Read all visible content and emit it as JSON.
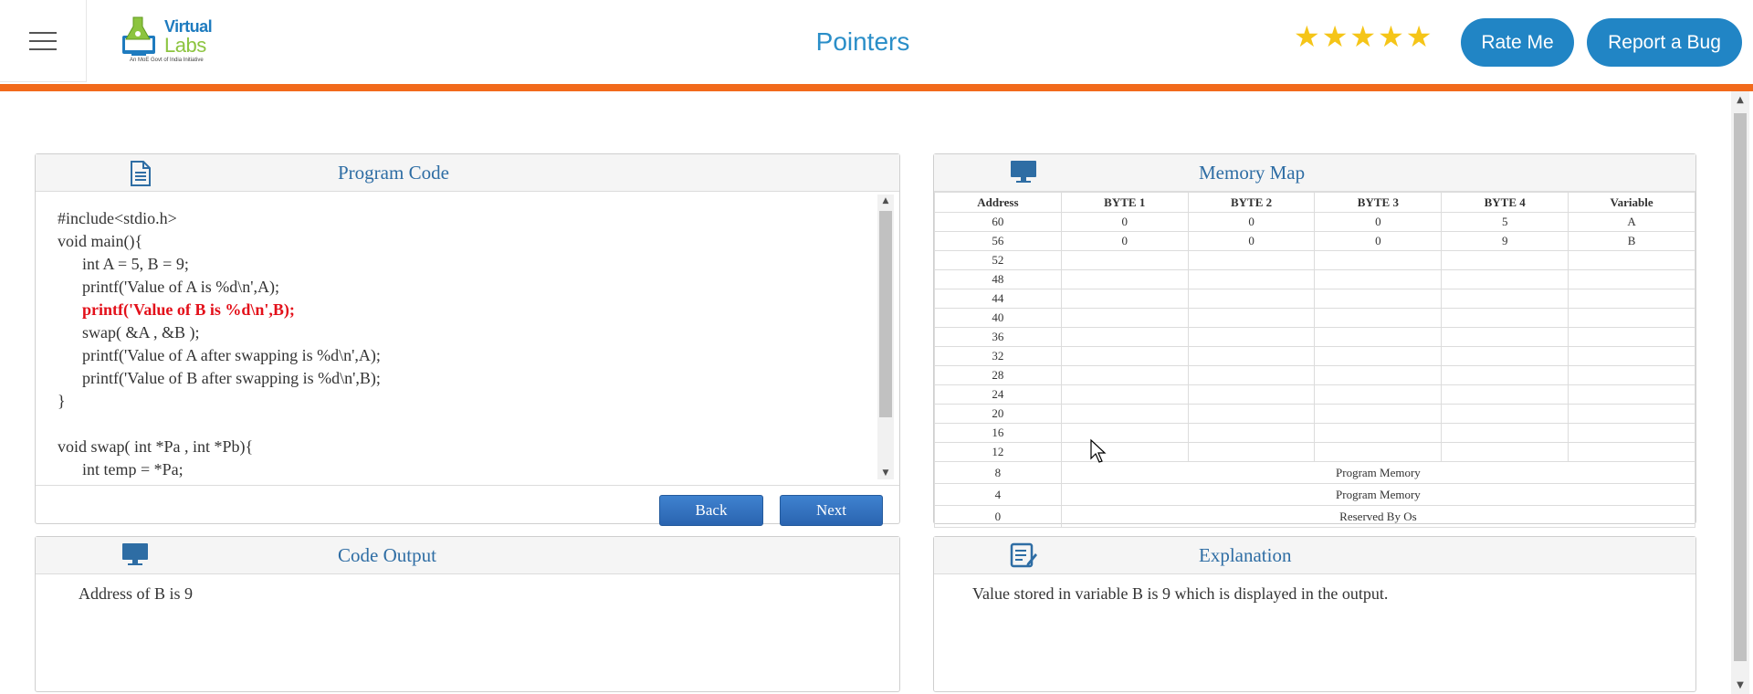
{
  "header": {
    "logo_line1": "Virtual",
    "logo_line2": "Labs",
    "logo_tagline": "An MoE Govt of India Initiative",
    "title": "Pointers",
    "rating_stars": 5,
    "rate_label": "Rate Me",
    "bug_label": "Report a Bug",
    "accent_color": "#f26a1b",
    "brand_color": "#2185c5"
  },
  "code_panel": {
    "title": "Program Code",
    "icon": "document-icon",
    "lines": [
      {
        "text": "#include<stdio.h>",
        "highlight": false
      },
      {
        "text": "void main(){",
        "highlight": false
      },
      {
        "text": "      int A = 5, B = 9;",
        "highlight": false
      },
      {
        "text": "      printf('Value of A is %d\\n',A);",
        "highlight": false
      },
      {
        "text": "      printf('Value of B is %d\\n',B);",
        "highlight": true
      },
      {
        "text": "      swap( &A , &B );",
        "highlight": false
      },
      {
        "text": "      printf('Value of A after swapping is %d\\n',A);",
        "highlight": false
      },
      {
        "text": "      printf('Value of B after swapping is %d\\n',B);",
        "highlight": false
      },
      {
        "text": "}",
        "highlight": false
      },
      {
        "text": "",
        "highlight": false
      },
      {
        "text": "void swap( int *Pa , int *Pb){",
        "highlight": false
      },
      {
        "text": "      int temp = *Pa;",
        "highlight": false
      }
    ],
    "back_label": "Back",
    "next_label": "Next"
  },
  "memory_panel": {
    "title": "Memory Map",
    "icon": "monitor-icon",
    "headers": [
      "Address",
      "BYTE 1",
      "BYTE 2",
      "BYTE 3",
      "BYTE 4",
      "Variable"
    ],
    "rows": [
      [
        "60",
        "0",
        "0",
        "0",
        "5",
        "A"
      ],
      [
        "56",
        "0",
        "0",
        "0",
        "9",
        "B"
      ],
      [
        "52",
        "",
        "",
        "",
        "",
        ""
      ],
      [
        "48",
        "",
        "",
        "",
        "",
        ""
      ],
      [
        "44",
        "",
        "",
        "",
        "",
        ""
      ],
      [
        "40",
        "",
        "",
        "",
        "",
        ""
      ],
      [
        "36",
        "",
        "",
        "",
        "",
        ""
      ],
      [
        "32",
        "",
        "",
        "",
        "",
        ""
      ],
      [
        "28",
        "",
        "",
        "",
        "",
        ""
      ],
      [
        "24",
        "",
        "",
        "",
        "",
        ""
      ],
      [
        "20",
        "",
        "",
        "",
        "",
        ""
      ],
      [
        "16",
        "",
        "",
        "",
        "",
        ""
      ],
      [
        "12",
        "",
        "",
        "",
        "",
        ""
      ]
    ],
    "program_rows": [
      [
        "8",
        "Program Memory"
      ],
      [
        "4",
        "Program Memory"
      ],
      [
        "0",
        "Reserved By Os"
      ]
    ]
  },
  "output_panel": {
    "title": "Code Output",
    "icon": "monitor-icon",
    "text": "Address of B is 9"
  },
  "explanation_panel": {
    "title": "Explanation",
    "icon": "edit-list-icon",
    "text": "Value stored in variable B is 9 which is displayed in the output."
  }
}
